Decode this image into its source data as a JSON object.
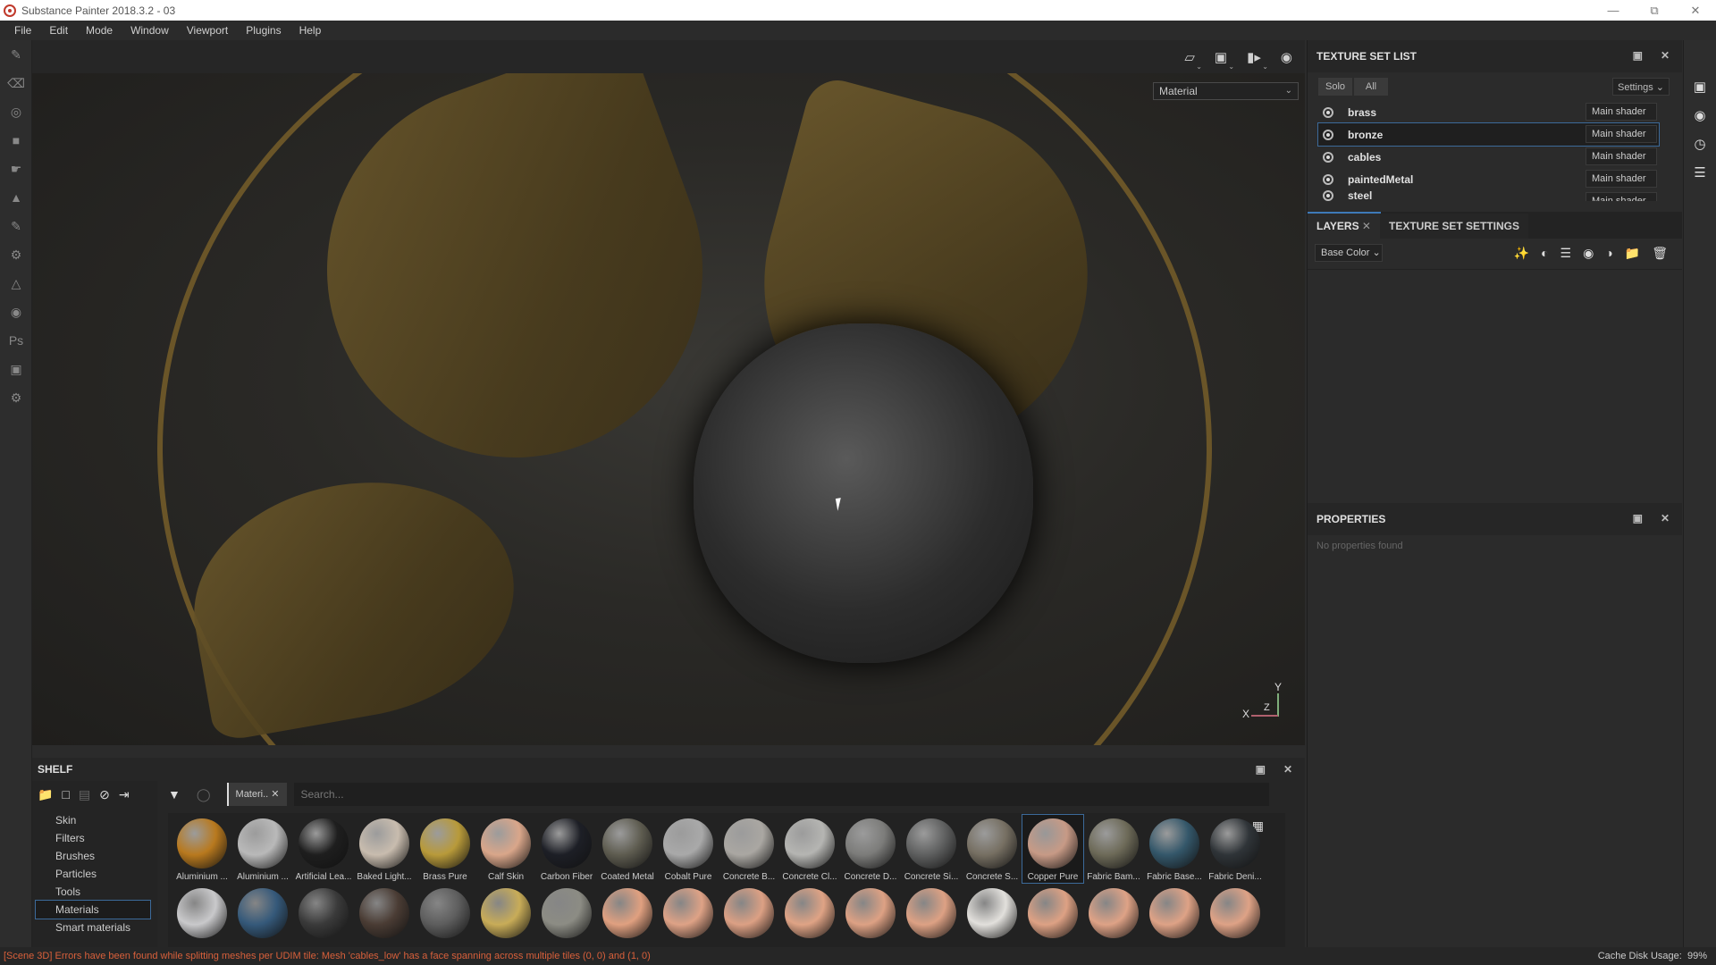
{
  "window": {
    "title": "Substance Painter 2018.3.2 - 03",
    "controls": [
      "minimize",
      "restore",
      "close"
    ]
  },
  "menu": [
    "File",
    "Edit",
    "Mode",
    "Window",
    "Viewport",
    "Plugins",
    "Help"
  ],
  "viewport": {
    "toolbar_icons": [
      "perspective-icon",
      "environment-icon",
      "camera-icon",
      "screenshot-icon"
    ],
    "channel_select": "Material",
    "gizmo": {
      "x": "X",
      "y": "Y",
      "z": "Z"
    }
  },
  "texture_set_list": {
    "title": "TEXTURE SET LIST",
    "solo_label": "Solo",
    "all_label": "All",
    "settings_label": "Settings",
    "items": [
      {
        "name": "brass",
        "shader": "Main shader"
      },
      {
        "name": "bronze",
        "shader": "Main shader",
        "selected": true
      },
      {
        "name": "cables",
        "shader": "Main shader"
      },
      {
        "name": "paintedMetal",
        "shader": "Main shader"
      },
      {
        "name": "steel",
        "shader": "Main shader"
      }
    ]
  },
  "layers": {
    "tab_layers": "LAYERS",
    "tab_texture_set_settings": "TEXTURE SET SETTINGS",
    "channel": "Base Color"
  },
  "properties": {
    "title": "PROPERTIES",
    "empty": "No properties found"
  },
  "shelf": {
    "title": "SHELF",
    "categories": [
      "Skin",
      "Filters",
      "Brushes",
      "Particles",
      "Tools",
      "Materials",
      "Smart materials"
    ],
    "selected_category": "Materials",
    "filter_chip": "Materi..",
    "search_placeholder": "Search...",
    "materials_row1": [
      {
        "name": "Aluminium ...",
        "color": "#b8791e"
      },
      {
        "name": "Aluminium ...",
        "color": "#b9b9b9"
      },
      {
        "name": "Artificial Lea...",
        "color": "#1e1e1e"
      },
      {
        "name": "Baked Light...",
        "color": "#c8bcae"
      },
      {
        "name": "Brass Pure",
        "color": "#b89a3a"
      },
      {
        "name": "Calf Skin",
        "color": "#d9a68a"
      },
      {
        "name": "Carbon Fiber",
        "color": "#1d1f26"
      },
      {
        "name": "Coated Metal",
        "color": "#5e5c50"
      },
      {
        "name": "Cobalt Pure",
        "color": "#a9a9a9"
      },
      {
        "name": "Concrete B...",
        "color": "#aaa7a2"
      },
      {
        "name": "Concrete Cl...",
        "color": "#b5b5b2"
      },
      {
        "name": "Concrete D...",
        "color": "#7c7c7a"
      },
      {
        "name": "Concrete Si...",
        "color": "#5f6060"
      },
      {
        "name": "Concrete S...",
        "color": "#766f62"
      },
      {
        "name": "Copper Pure",
        "color": "#c79a86",
        "selected": true
      },
      {
        "name": "Fabric Bam...",
        "color": "#6d6a58"
      },
      {
        "name": "Fabric Base...",
        "color": "#34576a"
      },
      {
        "name": "Fabric Deni...",
        "color": "#2f3438"
      }
    ],
    "materials_row2_colors": [
      "#c9c9cb",
      "#35597a",
      "#3a3a3a",
      "#4a3c34",
      "#5d5d5d",
      "#c8ac58",
      "#8c8c84",
      "#e0a080",
      "#dea286",
      "#dca084",
      "#dfa385",
      "#dda184",
      "#dda184",
      "#e2e0dc",
      "#dda184",
      "#dea286",
      "#dea286",
      "#dea286"
    ]
  },
  "status": {
    "error": "[Scene 3D] Errors have been found while splitting meshes per UDIM tile: Mesh 'cables_low' has a face spanning across multiple tiles (0, 0) and (1, 0)",
    "cache": "Cache Disk Usage:",
    "cache_value": "99%",
    "error_color": "#d9603b"
  }
}
